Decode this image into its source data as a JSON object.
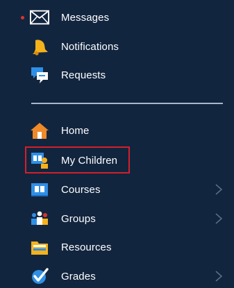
{
  "sidebar": {
    "top_items": [
      {
        "label": "Messages",
        "icon": "envelope-icon",
        "has_unread_dot": true
      },
      {
        "label": "Notifications",
        "icon": "bell-icon"
      },
      {
        "label": "Requests",
        "icon": "chat-bubbles-icon"
      }
    ],
    "main_items": [
      {
        "label": "Home",
        "icon": "home-icon",
        "has_submenu": false
      },
      {
        "label": "My Children",
        "icon": "children-icon",
        "has_submenu": false,
        "highlighted": true
      },
      {
        "label": "Courses",
        "icon": "courses-icon",
        "has_submenu": true
      },
      {
        "label": "Groups",
        "icon": "groups-icon",
        "has_submenu": true
      },
      {
        "label": "Resources",
        "icon": "resources-icon",
        "has_submenu": false
      },
      {
        "label": "Grades",
        "icon": "grades-icon",
        "has_submenu": true
      }
    ]
  },
  "colors": {
    "background": "#12253f",
    "highlight_border": "#d51f2a",
    "unread_dot": "#e0322c",
    "divider": "#a9b7c7",
    "text": "#ffffff"
  }
}
